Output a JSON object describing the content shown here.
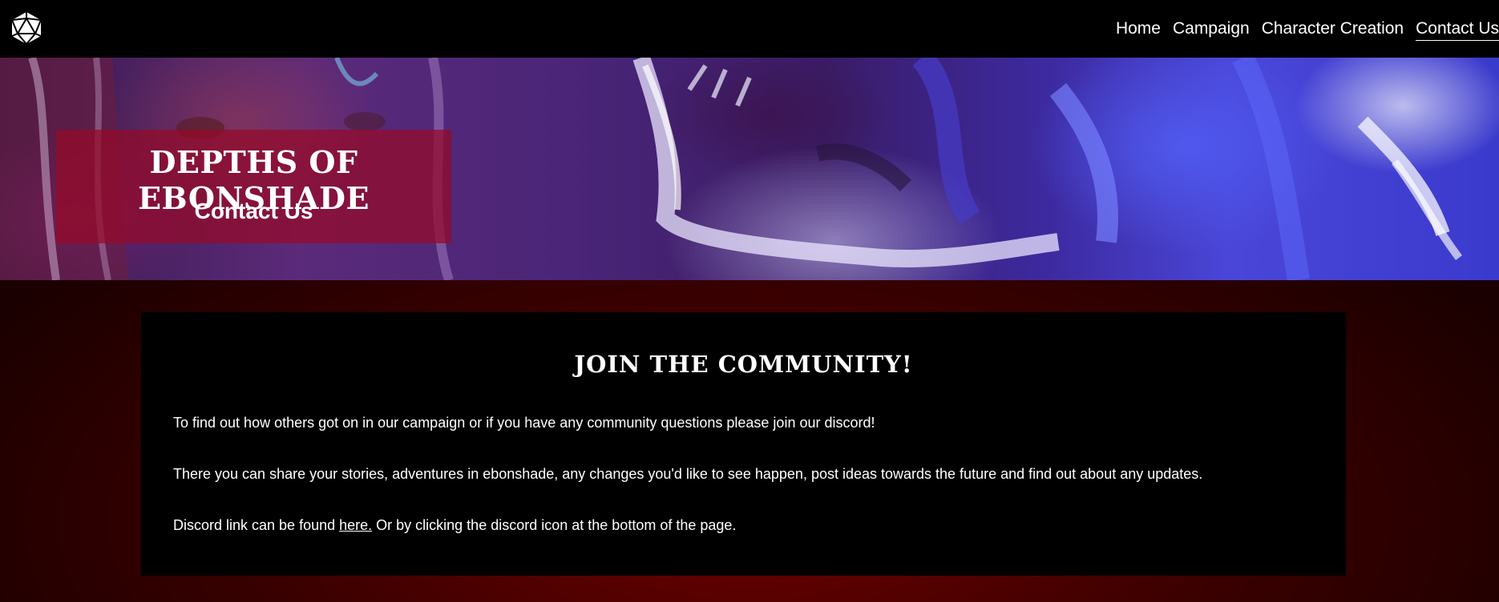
{
  "nav": {
    "logo_icon": "d20-dice-icon",
    "links": [
      {
        "label": "Home",
        "active": false
      },
      {
        "label": "Campaign",
        "active": false
      },
      {
        "label": "Character Creation",
        "active": false
      },
      {
        "label": "Contact Us",
        "active": true
      }
    ]
  },
  "hero": {
    "title": "DEPTHS OF EBONSHADE",
    "subtitle": "Contact Us"
  },
  "content": {
    "heading": "JOIN THE COMMUNITY!",
    "paragraph_1": "To find out how others got on in our campaign or if you have any community questions please join our discord!",
    "paragraph_2": "There you can share your stories, adventures in ebonshade, any changes you'd like to see happen, post ideas towards the future and find out about any updates.",
    "paragraph_3_before": "Discord link can be found ",
    "paragraph_3_link": "here.",
    "paragraph_3_after": " Or by clicking the discord icon at the bottom of the page."
  },
  "colors": {
    "navbar_bg": "#000000",
    "title_box_bg": "#960a28",
    "main_bg": "#5a0000",
    "card_bg": "#000000",
    "text": "#ffffff"
  }
}
